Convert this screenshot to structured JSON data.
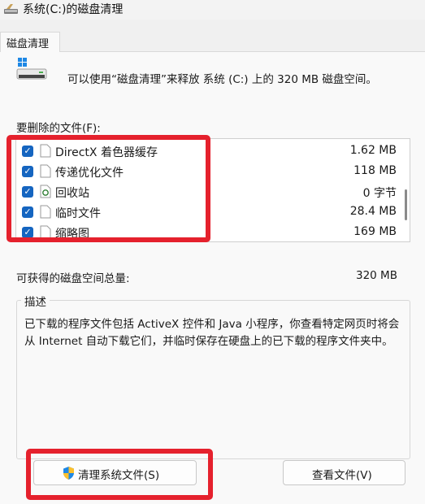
{
  "window": {
    "title": "系统(C:)的磁盘清理",
    "title_icon": "disk-cleanup-icon"
  },
  "tabs": [
    {
      "label": "磁盘清理",
      "selected": true
    }
  ],
  "intro_text": "可以使用“磁盘清理”来释放 系统 (C:) 上的 320 MB 磁盘空间。",
  "drive_icon": "drive-icon",
  "files_label": "要删除的文件(F):",
  "files": [
    {
      "name": "DirectX 着色器缓存",
      "size": "1.62 MB",
      "checked": true,
      "icon": "file-icon"
    },
    {
      "name": "传递优化文件",
      "size": "118 MB",
      "checked": true,
      "icon": "file-icon"
    },
    {
      "name": "回收站",
      "size": "0 字节",
      "checked": true,
      "icon": "recycle-bin-icon"
    },
    {
      "name": "临时文件",
      "size": "28.4 MB",
      "checked": true,
      "icon": "file-icon"
    },
    {
      "name": "缩略图",
      "size": "169 MB",
      "checked": true,
      "icon": "file-icon"
    }
  ],
  "total": {
    "label": "可获得的磁盘空间总量:",
    "value": "320 MB"
  },
  "description": {
    "label": "描述",
    "text": "已下载的程序文件包括 ActiveX 控件和 Java 小程序，你查看特定网页时将会从 Internet 自动下载它们，并临时保存在硬盘上的已下载的程序文件夹中。"
  },
  "buttons": {
    "clean_system": {
      "label": "清理系统文件(S)",
      "icon": "shield-icon"
    },
    "view_files": {
      "label": "查看文件(V)"
    }
  },
  "colors": {
    "checkbox": "#1565c0",
    "annotation": "#e5212d"
  }
}
